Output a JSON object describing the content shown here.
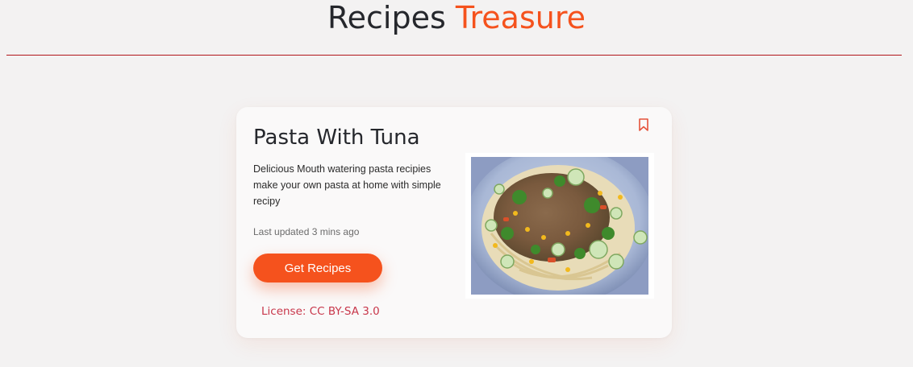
{
  "site": {
    "title_main": "Recipes",
    "title_accent": "Treasure",
    "accent_color": "#f5521d"
  },
  "card": {
    "title": "Pasta With Tuna",
    "description": "Delicious Mouth watering pasta recipies make your own pasta at home with simple recipy",
    "updated": "Last updated 3 mins ago",
    "button_label": "Get Recipes",
    "license": "License: CC BY-SA 3.0",
    "bookmark_icon": "bookmark-icon",
    "image_alt": "pasta-with-tuna-photo"
  }
}
